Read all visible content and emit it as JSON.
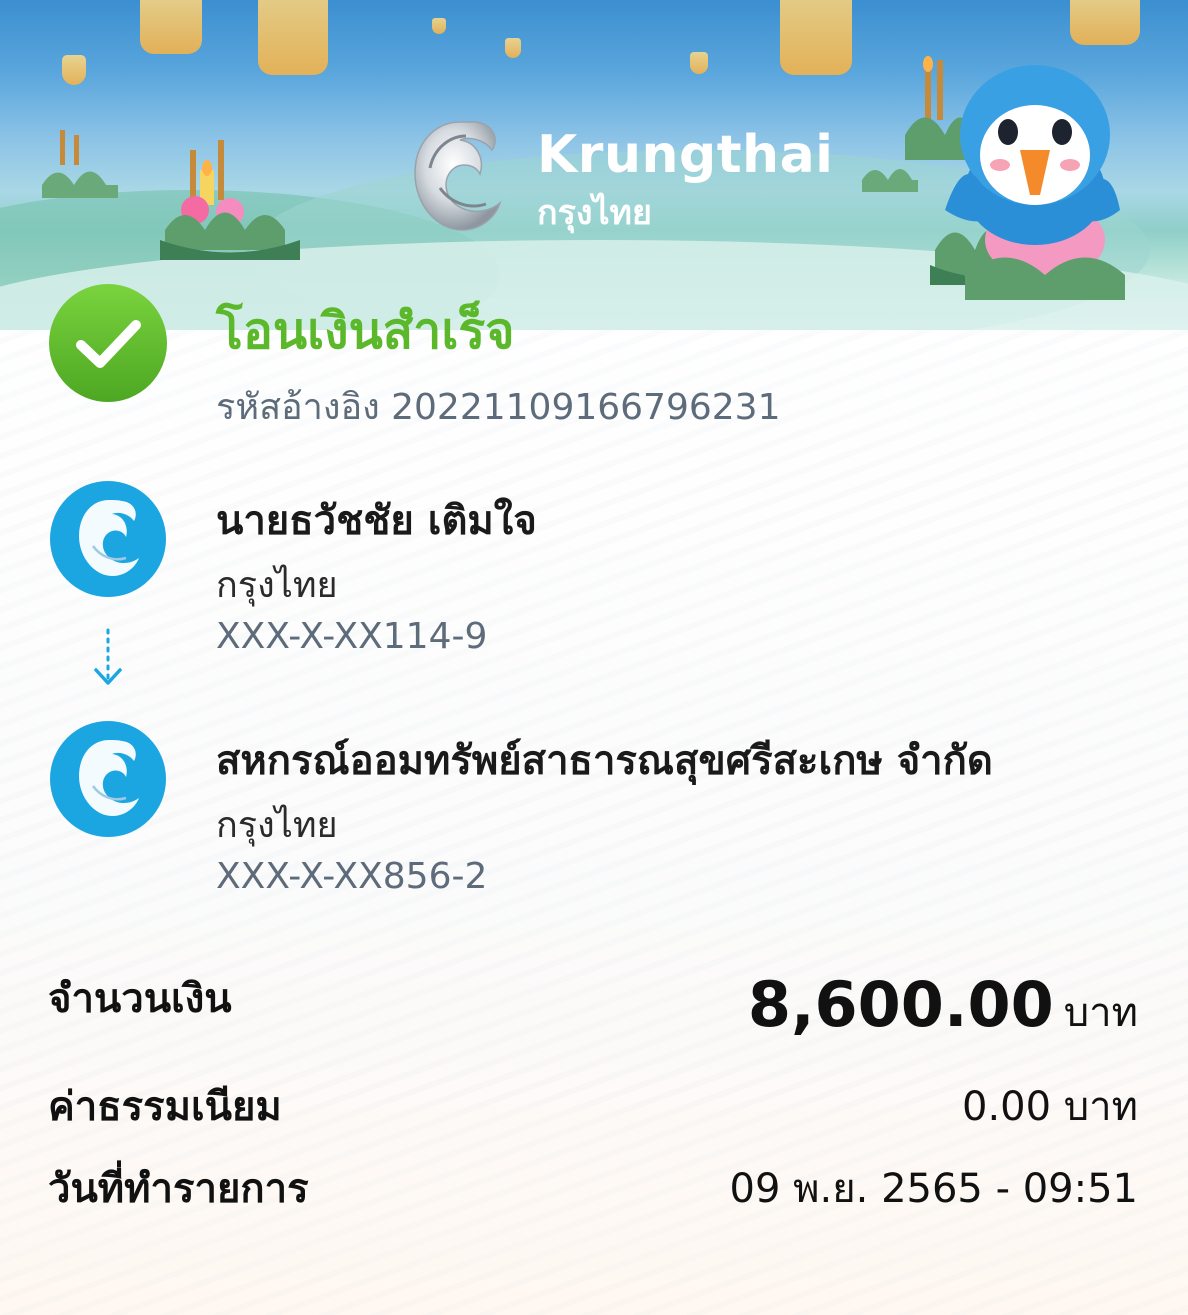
{
  "header": {
    "brand_en": "Krungthai",
    "brand_th": "กรุงไทย"
  },
  "status": {
    "title": "โอนเงินสำเร็จ",
    "reference_label": "รหัสอ้างอิง",
    "reference_number": "2022110916679623 1"
  },
  "sender": {
    "name": "นายธวัชชัย เติมใจ",
    "bank": "กรุงไทย",
    "account": "XXX-X-XX114-9"
  },
  "receiver": {
    "name": "สหกรณ์ออมทรัพย์สาธารณสุขศรีสะเกษ จำกัด",
    "bank": "กรุงไทย",
    "account": "XXX-X-XX856-2"
  },
  "details": {
    "amount_label": "จำนวนเงิน",
    "amount_value": "8,600.00",
    "amount_unit": "บาท",
    "fee_label": "ค่าธรรมเนียม",
    "fee_value": "0.00 บาท",
    "date_label": "วันที่ทำรายการ",
    "date_value": "09 พ.ย. 2565 - 09:51"
  },
  "colors": {
    "success_green": "#5cb82b",
    "krungthai_blue": "#1ba6e2",
    "text_gray": "#5d6b7a"
  },
  "icons": {
    "status": "check-icon",
    "bank": "krungthai-logo-icon",
    "transfer": "arrow-down-icon"
  }
}
